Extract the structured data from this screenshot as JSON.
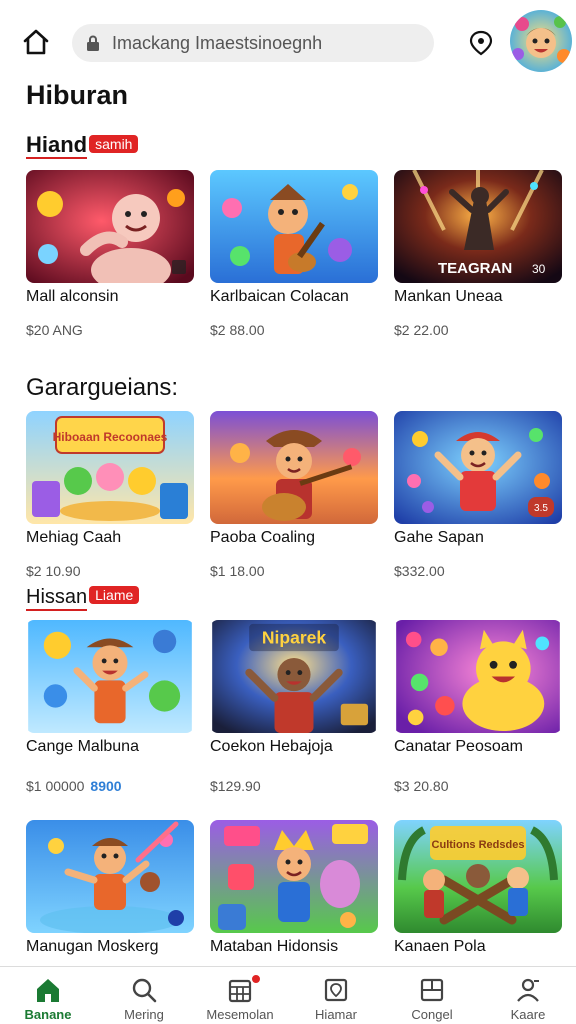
{
  "browser": {
    "url_text": "Imackang Imaestsinoegnh"
  },
  "page": {
    "title": "Hiburan"
  },
  "sections": [
    {
      "title": "Hiand",
      "badge": "samih",
      "items": [
        {
          "name": "Mall alconsin",
          "price": "$20 ANG"
        },
        {
          "name": "Karlbaican Colacan",
          "price": "$2 88.00"
        },
        {
          "name": "Mankan Uneaa",
          "price": "$2 22.00",
          "thumb_text": "TEAGRAN",
          "thumb_badge": "30"
        }
      ]
    },
    {
      "title": "Garargueians:",
      "items": [
        {
          "name": "Mehiag Caah",
          "price": "$2 10.90",
          "thumb_text": "Hiboaan Recoonaes"
        },
        {
          "name": "Paoba Coaling",
          "price": "$1 18.00"
        },
        {
          "name": "Gahe Sapan",
          "price": "$332.00",
          "thumb_badge": "3.5"
        }
      ]
    },
    {
      "title": "Hissan",
      "badge": "Liame",
      "items": [
        {
          "name": "Cange Malbuna",
          "price": "$1 00000",
          "price_extra": "8900"
        },
        {
          "name": "Coekon Hebajoja",
          "price": "$129.90",
          "thumb_text": "Niparek"
        },
        {
          "name": "Canatar Peosoam",
          "price": "$3 20.80"
        }
      ]
    },
    {
      "items": [
        {
          "name": "Manugan Moskerg"
        },
        {
          "name": "Mataban Hidonsis"
        },
        {
          "name": "Kanaen Pola",
          "thumb_text": "Cultions Redsdes"
        }
      ]
    }
  ],
  "tabs": [
    {
      "label": "Banane",
      "icon": "home-icon",
      "active": true
    },
    {
      "label": "Mering",
      "icon": "search-icon"
    },
    {
      "label": "Mesemolan",
      "icon": "calendar-icon",
      "notification": true
    },
    {
      "label": "Hiamar",
      "icon": "location-pin-icon"
    },
    {
      "label": "Congel",
      "icon": "grid-icon"
    },
    {
      "label": "Kaare",
      "icon": "profile-icon"
    }
  ],
  "colors": {
    "accent": "#1b7a33",
    "badge": "#e02424",
    "search_bg": "#eeeeee"
  }
}
